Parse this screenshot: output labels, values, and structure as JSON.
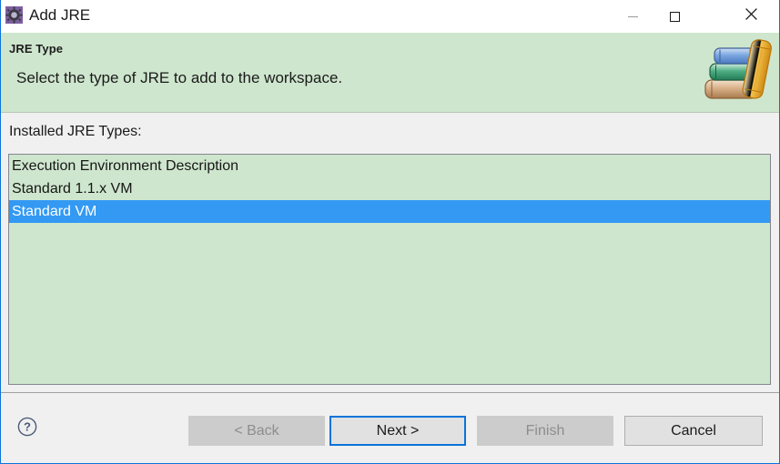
{
  "window": {
    "title": "Add JRE",
    "icon": "jre-gear-icon",
    "controls": {
      "minimize": "minimize-icon",
      "maximize": "maximize-icon",
      "close": "close-icon"
    },
    "accent_color": "#0a74da"
  },
  "header": {
    "title": "JRE Type",
    "description": "Select the type of JRE to add to the workspace.",
    "background_color": "#cee6ce",
    "art": "books-stack-icon"
  },
  "main": {
    "list_label": "Installed JRE Types:",
    "list_background_color": "#cee6ce",
    "selection_color": "#3399f3",
    "items": [
      {
        "label": "Execution Environment Description",
        "selected": false
      },
      {
        "label": "Standard 1.1.x VM",
        "selected": false
      },
      {
        "label": "Standard VM",
        "selected": true
      }
    ]
  },
  "footer": {
    "help": "help-icon",
    "buttons": [
      {
        "label": "< Back",
        "state": "disabled"
      },
      {
        "label": "Next >",
        "state": "default"
      },
      {
        "label": "Finish",
        "state": "disabled"
      },
      {
        "label": "Cancel",
        "state": "normal"
      }
    ]
  }
}
